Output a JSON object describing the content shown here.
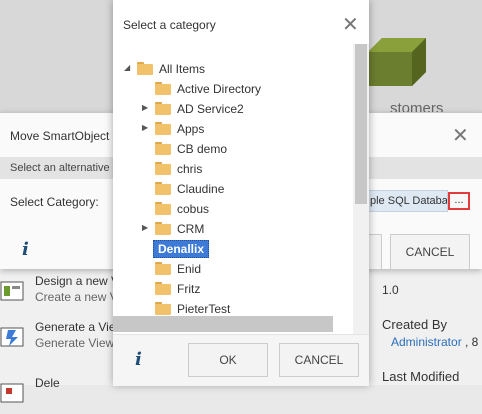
{
  "background": {
    "heading_partial": "stomers",
    "items": [
      {
        "title": "Design a new V",
        "subtitle": "Create a new V"
      },
      {
        "title": "Generate a Vie",
        "subtitle": "Generate View"
      },
      {
        "title": "Dele",
        "subtitle": ""
      }
    ],
    "version": "1.0",
    "created_by_label": "Created By",
    "created_by_value": "Administrator",
    "created_by_suffix": ", 8",
    "last_modified_label": "Last Modified"
  },
  "move_dialog": {
    "title": "Move SmartObject (",
    "alternative_text": "Select an alternative",
    "category_label": "Select Category:",
    "category_value": "ple SQL Databas",
    "browse_label": "...",
    "cancel_label": "CANCEL"
  },
  "category_dialog": {
    "title": "Select a category",
    "tree": [
      {
        "label": "All Items",
        "level": 0,
        "arrow": "expanded"
      },
      {
        "label": "Active Directory",
        "level": 1,
        "arrow": "none"
      },
      {
        "label": "AD Service2",
        "level": 1,
        "arrow": "collapsed"
      },
      {
        "label": "Apps",
        "level": 1,
        "arrow": "collapsed"
      },
      {
        "label": "CB demo",
        "level": 1,
        "arrow": "none"
      },
      {
        "label": "chris",
        "level": 1,
        "arrow": "none"
      },
      {
        "label": "Claudine",
        "level": 1,
        "arrow": "none"
      },
      {
        "label": "cobus",
        "level": 1,
        "arrow": "none"
      },
      {
        "label": "CRM",
        "level": 1,
        "arrow": "collapsed"
      },
      {
        "label": "Denallix",
        "level": 1,
        "arrow": "none",
        "selected": true
      },
      {
        "label": "Enid",
        "level": 1,
        "arrow": "none"
      },
      {
        "label": "Fritz",
        "level": 1,
        "arrow": "none"
      },
      {
        "label": "PieterTest",
        "level": 1,
        "arrow": "none"
      }
    ],
    "ok_label": "OK",
    "cancel_label": "CANCEL"
  },
  "colors": {
    "selection": "#3d7bd6",
    "folder": "#f2c26b",
    "info_icon": "#1f4e79",
    "highlight_border": "#e23b3b"
  },
  "icons": [
    "close-icon",
    "info-icon",
    "folder-icon",
    "expand-arrow-icon",
    "collapse-arrow-icon",
    "cube-icon"
  ]
}
